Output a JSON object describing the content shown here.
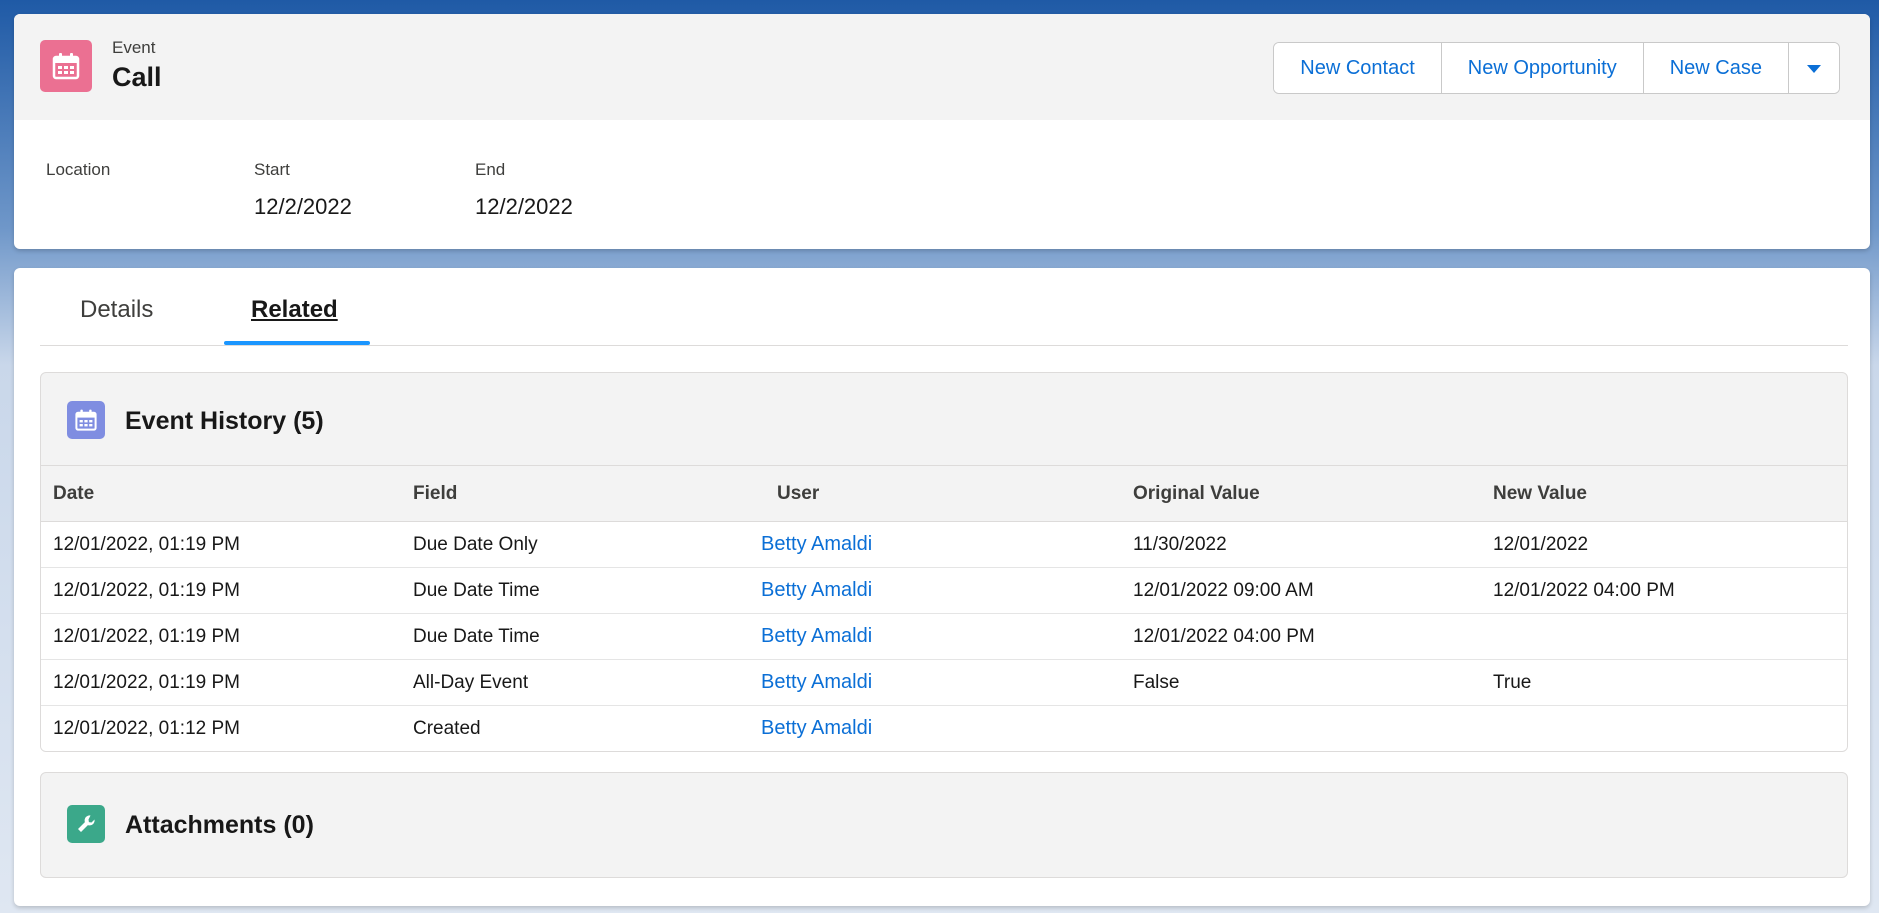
{
  "record": {
    "entity_label": "Event",
    "title": "Call",
    "icon": "calendar-icon",
    "icon_color": "#eb7092"
  },
  "actions": {
    "new_contact": "New Contact",
    "new_opportunity": "New Opportunity",
    "new_case": "New Case",
    "more_icon": "chevron-down-icon"
  },
  "fields": {
    "location_label": "Location",
    "location_value": "",
    "start_label": "Start",
    "start_value": "12/2/2022",
    "end_label": "End",
    "end_value": "12/2/2022"
  },
  "tabs": {
    "details": "Details",
    "related": "Related",
    "active": "Related"
  },
  "event_history": {
    "title": "Event History (5)",
    "icon": "calendar-icon",
    "icon_color": "#7f8de1",
    "columns": [
      "Date",
      "Field",
      "User",
      "Original Value",
      "New Value"
    ],
    "rows": [
      [
        "12/01/2022, 01:19 PM",
        "Due Date Only",
        "Betty Amaldi",
        "11/30/2022",
        "12/01/2022"
      ],
      [
        "12/01/2022, 01:19 PM",
        "Due Date Time",
        "Betty Amaldi",
        "12/01/2022 09:00 AM",
        "12/01/2022 04:00 PM"
      ],
      [
        "12/01/2022, 01:19 PM",
        "Due Date Time",
        "Betty Amaldi",
        "12/01/2022 04:00 PM",
        ""
      ],
      [
        "12/01/2022, 01:19 PM",
        "All-Day Event",
        "Betty Amaldi",
        "False",
        "True"
      ],
      [
        "12/01/2022, 01:12 PM",
        "Created",
        "Betty Amaldi",
        "",
        ""
      ]
    ]
  },
  "attachments": {
    "title": "Attachments (0)",
    "icon": "wrench-icon",
    "icon_color": "#3ba88a"
  },
  "colors": {
    "link": "#0b6fd6",
    "tab_indicator": "#1b96ff"
  }
}
